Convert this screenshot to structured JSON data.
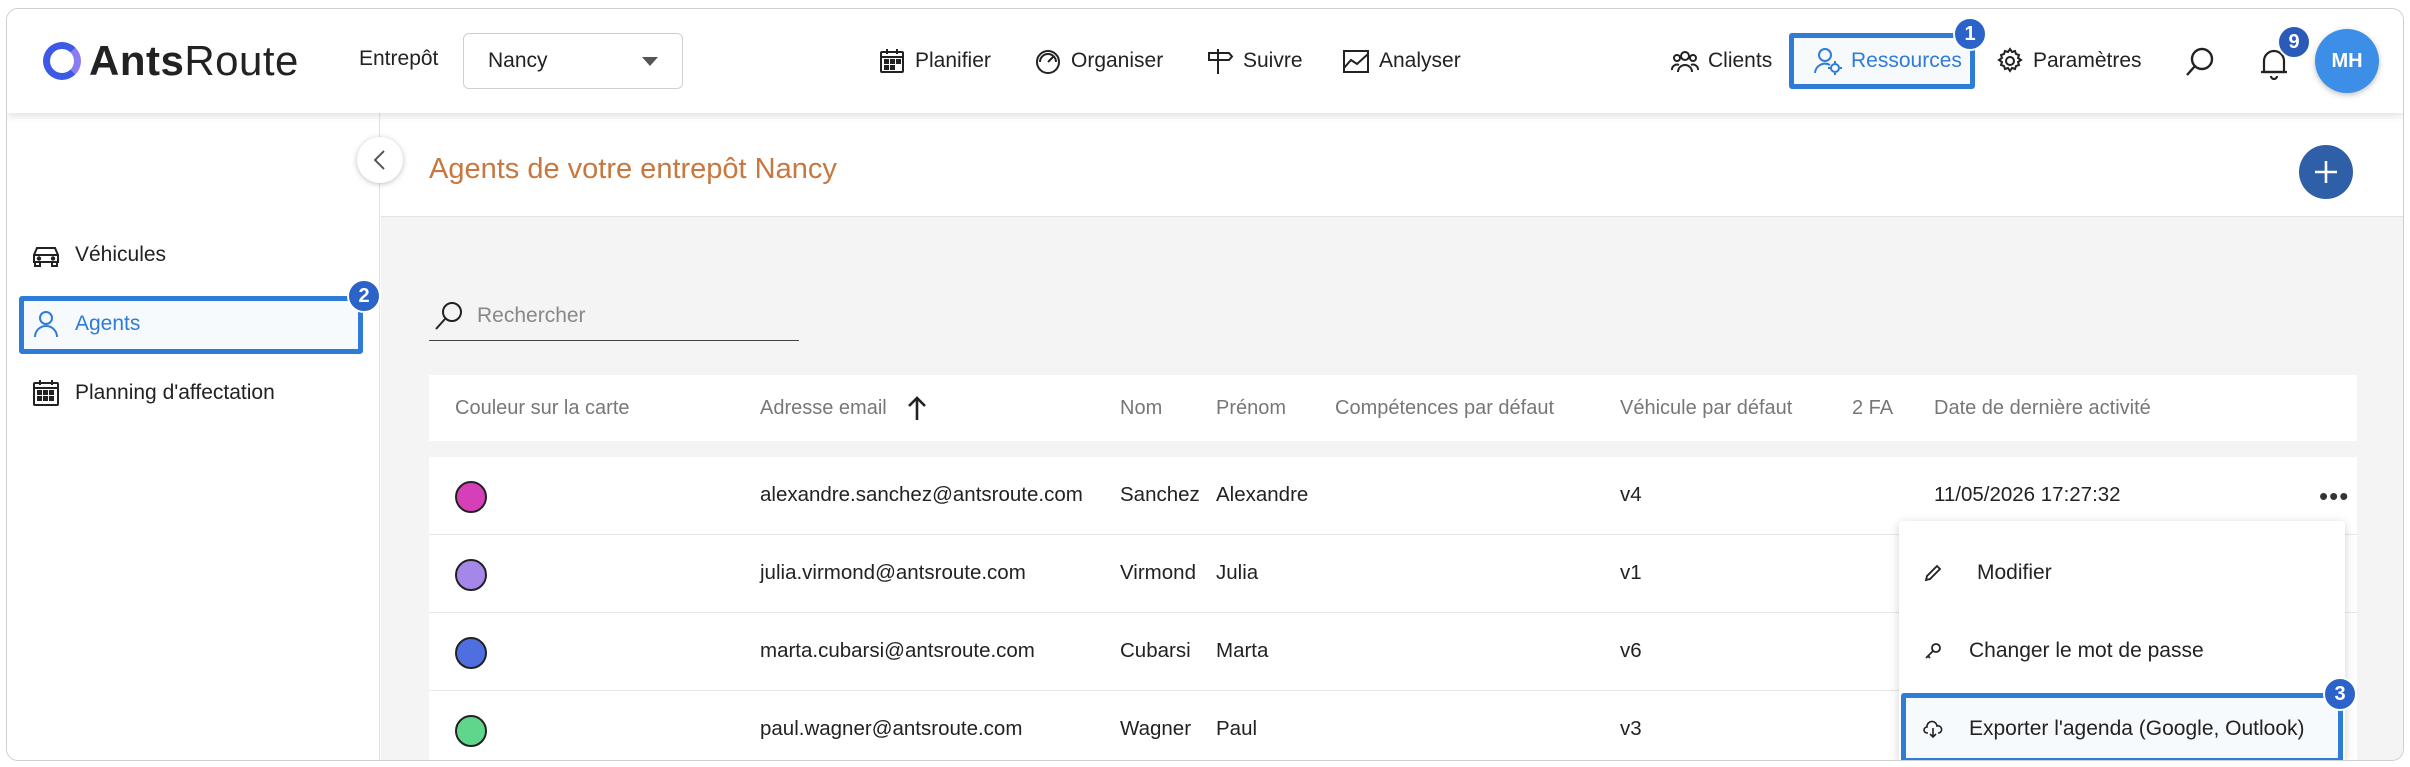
{
  "header": {
    "logo_text_bold": "Ants",
    "logo_text_light": "Route",
    "warehouse_label": "Entrepôt",
    "warehouse_value": "Nancy",
    "nav": [
      {
        "label": "Planifier",
        "icon": "calendar-icon"
      },
      {
        "label": "Organiser",
        "icon": "gauge-icon"
      },
      {
        "label": "Suivre",
        "icon": "signpost-icon"
      },
      {
        "label": "Analyser",
        "icon": "chart-icon"
      }
    ],
    "right_nav": [
      {
        "label": "Clients",
        "icon": "group-icon"
      },
      {
        "label": "Ressources",
        "icon": "user-gear-icon"
      },
      {
        "label": "Paramètres",
        "icon": "gear-icon"
      }
    ],
    "notification_count": "9",
    "avatar_initials": "MH"
  },
  "annotations": {
    "one": "1",
    "two": "2",
    "three": "3"
  },
  "sidebar": {
    "items": [
      {
        "label": "Véhicules",
        "icon": "car-icon"
      },
      {
        "label": "Agents",
        "icon": "user-icon"
      },
      {
        "label": "Planning d'affectation",
        "icon": "calendar-icon"
      }
    ]
  },
  "main": {
    "title": "Agents de votre entrepôt Nancy",
    "search_placeholder": "Rechercher"
  },
  "table": {
    "columns": [
      "Couleur sur la carte",
      "Adresse email",
      "Nom",
      "Prénom",
      "Compétences par défaut",
      "Véhicule par défaut",
      "2 FA",
      "Date de dernière activité"
    ],
    "rows": [
      {
        "color": "#d63fb8",
        "email": "alexandre.sanchez@antsroute.com",
        "nom": "Sanchez",
        "prenom": "Alexandre",
        "vehicule": "v4",
        "date": "11/05/2026 17:27:32"
      },
      {
        "color": "#a487e8",
        "email": "julia.virmond@antsroute.com",
        "nom": "Virmond",
        "prenom": "Julia",
        "vehicule": "v1",
        "date": ""
      },
      {
        "color": "#4f6fe0",
        "email": "marta.cubarsi@antsroute.com",
        "nom": "Cubarsi",
        "prenom": "Marta",
        "vehicule": "v6",
        "date": ""
      },
      {
        "color": "#5fd68c",
        "email": "paul.wagner@antsroute.com",
        "nom": "Wagner",
        "prenom": "Paul",
        "vehicule": "v3",
        "date": ""
      }
    ]
  },
  "context_menu": {
    "items": [
      {
        "label": "Modifier",
        "icon": "pencil-icon"
      },
      {
        "label": "Changer le mot de passe",
        "icon": "key-icon"
      },
      {
        "label": "Exporter l'agenda (Google, Outlook)",
        "icon": "cloud-download-icon"
      }
    ]
  }
}
